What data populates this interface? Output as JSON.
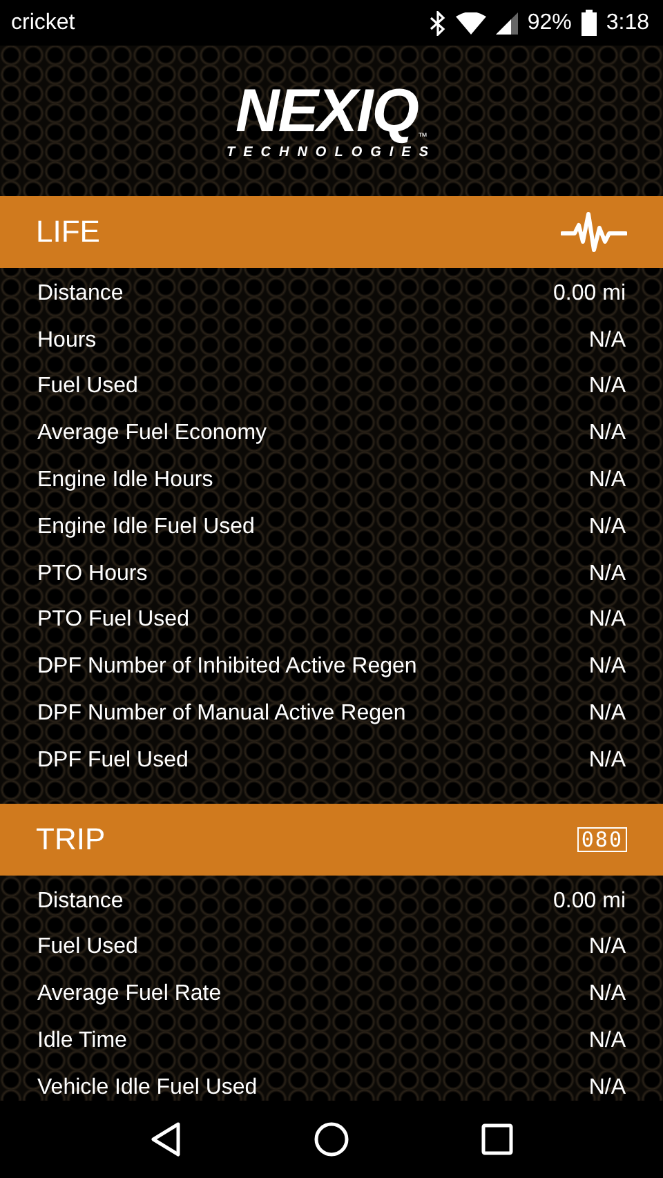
{
  "status_bar": {
    "carrier": "cricket",
    "battery": "92%",
    "time": "3:18"
  },
  "logo": {
    "name": "NEXIQ",
    "tagline": "TECHNOLOGIES",
    "mark": "™"
  },
  "sections": [
    {
      "title": "LIFE",
      "kind": "pulse",
      "rows": [
        {
          "label": "Distance",
          "value": "0.00 mi"
        },
        {
          "label": "Hours",
          "value": "N/A"
        },
        {
          "label": "Fuel Used",
          "value": "N/A"
        },
        {
          "label": "Average Fuel Economy",
          "value": "N/A"
        },
        {
          "label": "Engine Idle Hours",
          "value": "N/A"
        },
        {
          "label": "Engine Idle Fuel Used",
          "value": "N/A"
        },
        {
          "label": "PTO Hours",
          "value": "N/A"
        },
        {
          "label": "PTO Fuel Used",
          "value": "N/A"
        },
        {
          "label": "DPF Number of Inhibited Active Regen",
          "value": "N/A"
        },
        {
          "label": "DPF Number of Manual Active Regen",
          "value": "N/A"
        },
        {
          "label": "DPF Fuel Used",
          "value": "N/A"
        }
      ]
    },
    {
      "title": "TRIP",
      "kind": "odometer",
      "icon_text": "080",
      "rows": [
        {
          "label": "Distance",
          "value": "0.00 mi"
        },
        {
          "label": "Fuel Used",
          "value": "N/A"
        },
        {
          "label": "Average Fuel Rate",
          "value": "N/A"
        },
        {
          "label": "Idle Time",
          "value": "N/A"
        },
        {
          "label": "Vehicle Idle Fuel Used",
          "value": "N/A"
        }
      ]
    }
  ]
}
